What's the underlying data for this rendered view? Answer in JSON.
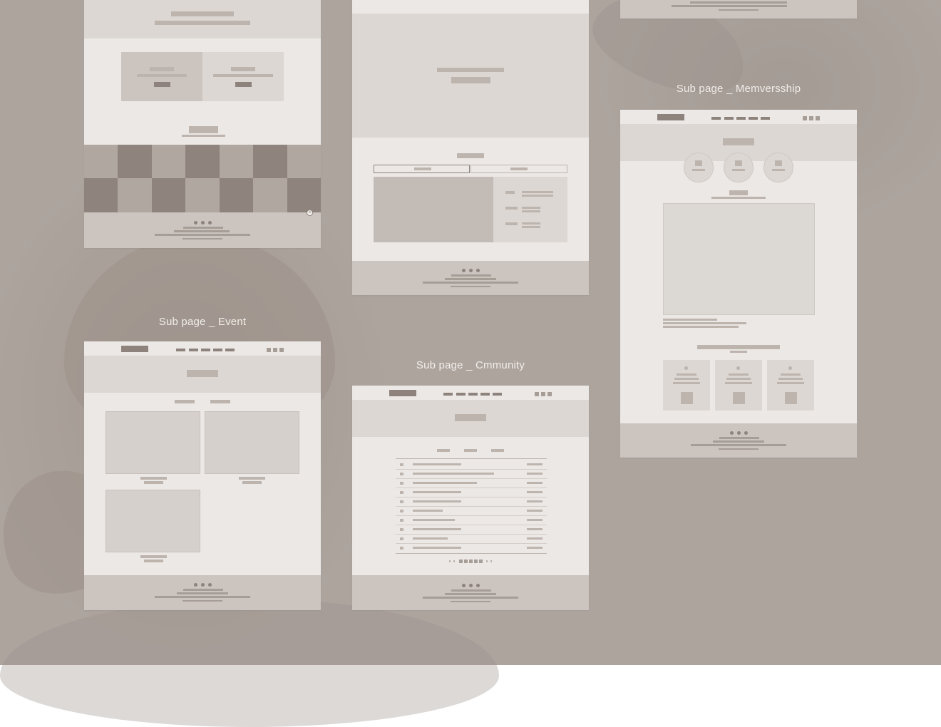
{
  "captions": {
    "event": "Sub page _ Event",
    "community": "Sub page _ Cmmunity",
    "membership": "Sub page _ Memversship"
  },
  "colors": {
    "background": "#ada49e",
    "artboard": "#ece8e5",
    "hero": "#dcd7d3",
    "footer": "#cbc4bf",
    "placeholder_dark": "#8e837c",
    "placeholder_light": "#bdb4ae",
    "caption_text": "#f1ede9"
  },
  "icons": {
    "close_marker": "close-icon"
  }
}
